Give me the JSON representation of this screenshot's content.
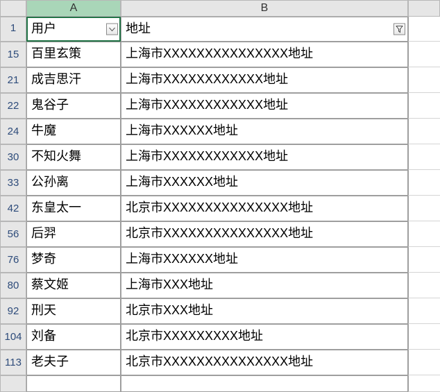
{
  "columns": {
    "A": "A",
    "B": "B"
  },
  "headers": {
    "col_a": "用户",
    "col_b": "地址",
    "row_number": "1"
  },
  "rows": [
    {
      "num": "15",
      "user": "百里玄策",
      "addr": "上海市XXXXXXXXXXXXXXX地址"
    },
    {
      "num": "21",
      "user": "成吉思汗",
      "addr": "上海市XXXXXXXXXXXX地址"
    },
    {
      "num": "22",
      "user": "鬼谷子",
      "addr": "上海市XXXXXXXXXXXX地址"
    },
    {
      "num": "24",
      "user": "牛魔",
      "addr": "上海市XXXXXX地址"
    },
    {
      "num": "30",
      "user": "不知火舞",
      "addr": "上海市XXXXXXXXXXXX地址"
    },
    {
      "num": "33",
      "user": "公孙离",
      "addr": "上海市XXXXXX地址"
    },
    {
      "num": "42",
      "user": "东皇太一",
      "addr": "北京市XXXXXXXXXXXXXXX地址"
    },
    {
      "num": "56",
      "user": "后羿",
      "addr": "北京市XXXXXXXXXXXXXXX地址"
    },
    {
      "num": "76",
      "user": "梦奇",
      "addr": "上海市XXXXXX地址"
    },
    {
      "num": "80",
      "user": "蔡文姬",
      "addr": "上海市XXX地址"
    },
    {
      "num": "92",
      "user": "刑天",
      "addr": "北京市XXX地址"
    },
    {
      "num": "104",
      "user": "刘备",
      "addr": "北京市XXXXXXXXX地址"
    },
    {
      "num": "113",
      "user": "老夫子",
      "addr": "北京市XXXXXXXXXXXXXXX地址"
    }
  ],
  "icons": {
    "filter_dropdown": "chevron-down",
    "filter_applied": "funnel"
  }
}
